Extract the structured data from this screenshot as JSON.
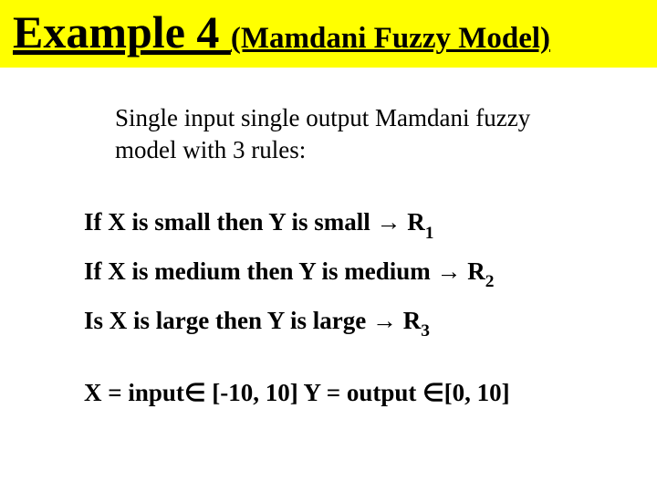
{
  "title": {
    "main": "Example 4 ",
    "sub": "(Mamdani Fuzzy Model)"
  },
  "intro": "Single input single output Mamdani fuzzy model with 3 rules:",
  "rules": [
    {
      "pre": "If X is small then Y is small ",
      "arrow": "→",
      "label": " R",
      "idx": "1"
    },
    {
      "pre": "If X is medium then Y is medium ",
      "arrow": "→",
      "label": " R",
      "idx": "2"
    },
    {
      "pre": "Is X is large then Y is large ",
      "arrow": "→",
      "label": " R",
      "idx": "3"
    }
  ],
  "domain": {
    "x_pre": "X = input",
    "x_sym": "∈",
    "x_range": " [-10, 10] ",
    "y_pre": "Y = output ",
    "y_sym": "∈",
    "y_range": "[0, 10]"
  }
}
